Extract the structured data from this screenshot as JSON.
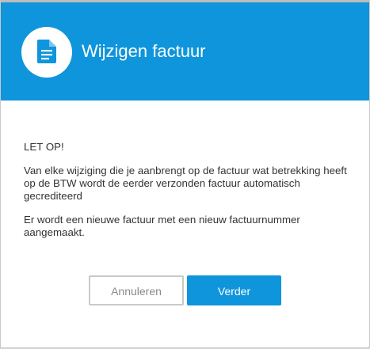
{
  "dialog": {
    "title": "Wijzigen factuur",
    "icon": "document-icon",
    "accent_color": "#0f95db"
  },
  "body": {
    "warning_heading": "LET OP!",
    "paragraph_1": "Van elke wijziging die je aanbrengt op de factuur wat betrekking heeft op de BTW wordt de eerder verzonden factuur automatisch gecrediteerd",
    "paragraph_2": "Er wordt een nieuwe factuur met een nieuw factuurnummer aangemaakt."
  },
  "buttons": {
    "cancel_label": "Annuleren",
    "next_label": "Verder"
  }
}
